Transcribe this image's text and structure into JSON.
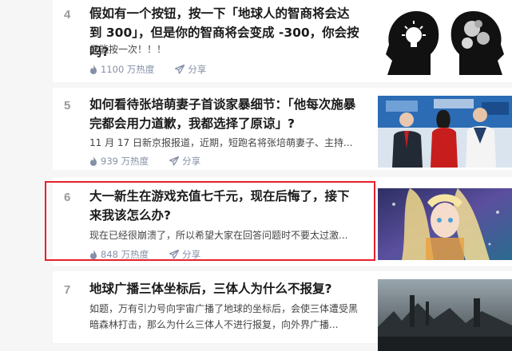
{
  "hot_list": {
    "items": [
      {
        "rank": "4",
        "title": "假如有一个按钮，按一下「地球人的智商将会达到 300」，但是你的智商将会变成 -300，你会按吗?",
        "excerpt": "只能按一次！！！",
        "heat": "1100 万热度",
        "share": "分享",
        "thumb_icon": "head-silhouettes-image"
      },
      {
        "rank": "5",
        "title": "如何看待张培萌妻子首谈家暴细节：「他每次施暴完都会用力道歉，我都选择了原谅」?",
        "excerpt": "11 月 17 日新京报报道，近期，短跑名将张培萌妻子、主持...",
        "heat": "939 万热度",
        "share": "分享",
        "thumb_icon": "event-photo-image"
      },
      {
        "rank": "6",
        "title": "大一新生在游戏充值七千元，现在后悔了，接下来我该怎么办?",
        "excerpt": "现在已经很崩溃了，所以希望大家在回答问题时不要太过激...",
        "heat": "848 万热度",
        "share": "分享",
        "thumb_icon": "game-character-image"
      },
      {
        "rank": "7",
        "title": "地球广播三体坐标后，三体人为什么不报复?",
        "excerpt": "如题，万有引力号向宇宙广播了地球的坐标后，会使三体遭受黑暗森林打击，那么为什么三体人不进行报复，向外界广播...",
        "heat": "",
        "share": "",
        "thumb_icon": "dark-scene-image"
      }
    ]
  },
  "colors": {
    "highlight_border": "#e8202a",
    "meta_text": "#8590a6",
    "rank_text": "#999999"
  }
}
